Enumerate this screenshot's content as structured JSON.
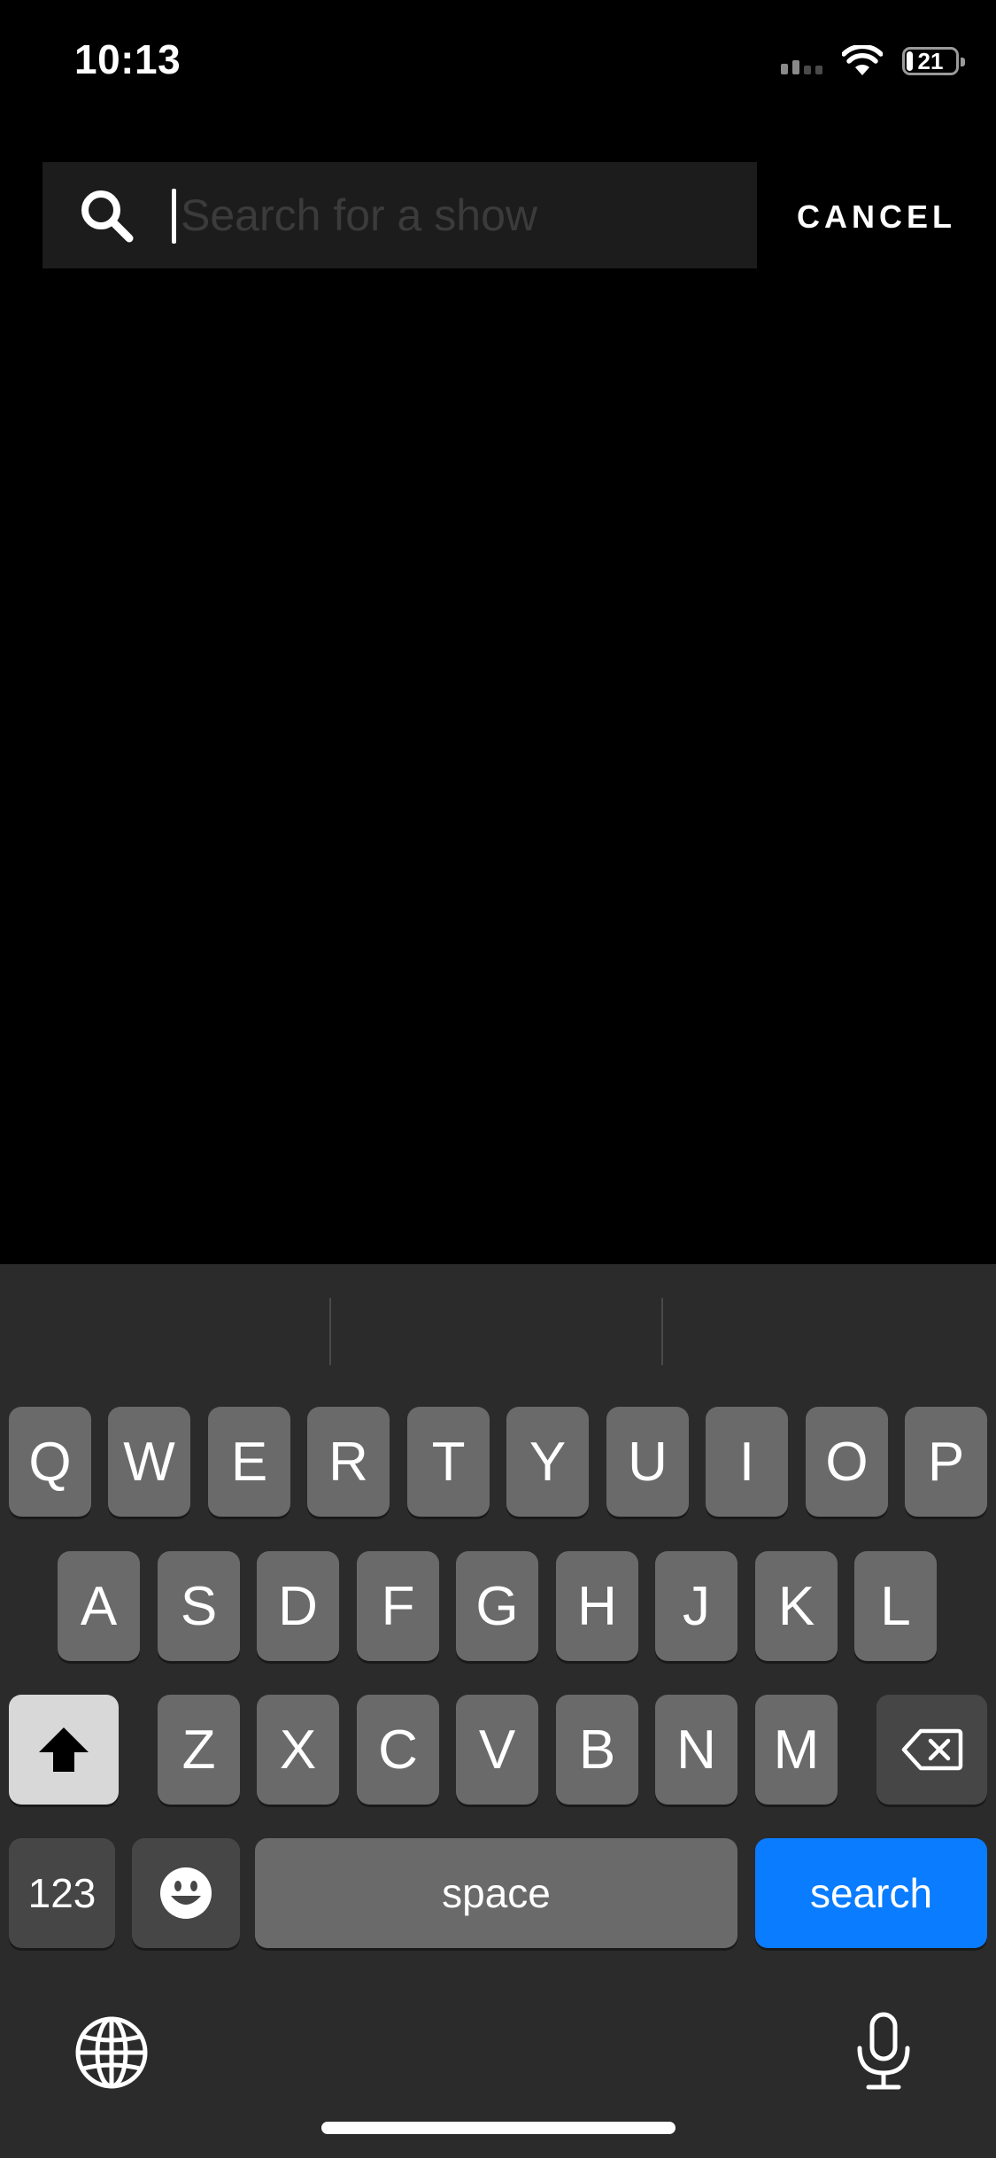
{
  "status_bar": {
    "time": "10:13",
    "battery_level": "21"
  },
  "search": {
    "placeholder": "Search for a show",
    "value": "",
    "cancel_label": "CANCEL"
  },
  "keyboard": {
    "row1": [
      "Q",
      "W",
      "E",
      "R",
      "T",
      "Y",
      "U",
      "I",
      "O",
      "P"
    ],
    "row2": [
      "A",
      "S",
      "D",
      "F",
      "G",
      "H",
      "J",
      "K",
      "L"
    ],
    "row3": [
      "Z",
      "X",
      "C",
      "V",
      "B",
      "N",
      "M"
    ],
    "numbers_label": "123",
    "space_label": "space",
    "search_label": "search"
  },
  "colors": {
    "background": "#000000",
    "search_field": "#1c1c1c",
    "keyboard_bg": "#2b2b2b",
    "key": "#6a6a6a",
    "key_dark": "#464646",
    "accent": "#0a7cff"
  },
  "icons": {
    "search": "search-icon",
    "shift": "shift-icon",
    "delete": "delete-icon",
    "emoji": "emoji-icon",
    "globe": "globe-icon",
    "mic": "microphone-icon",
    "wifi": "wifi-icon",
    "signal": "cellular-signal-icon",
    "battery": "battery-icon"
  }
}
